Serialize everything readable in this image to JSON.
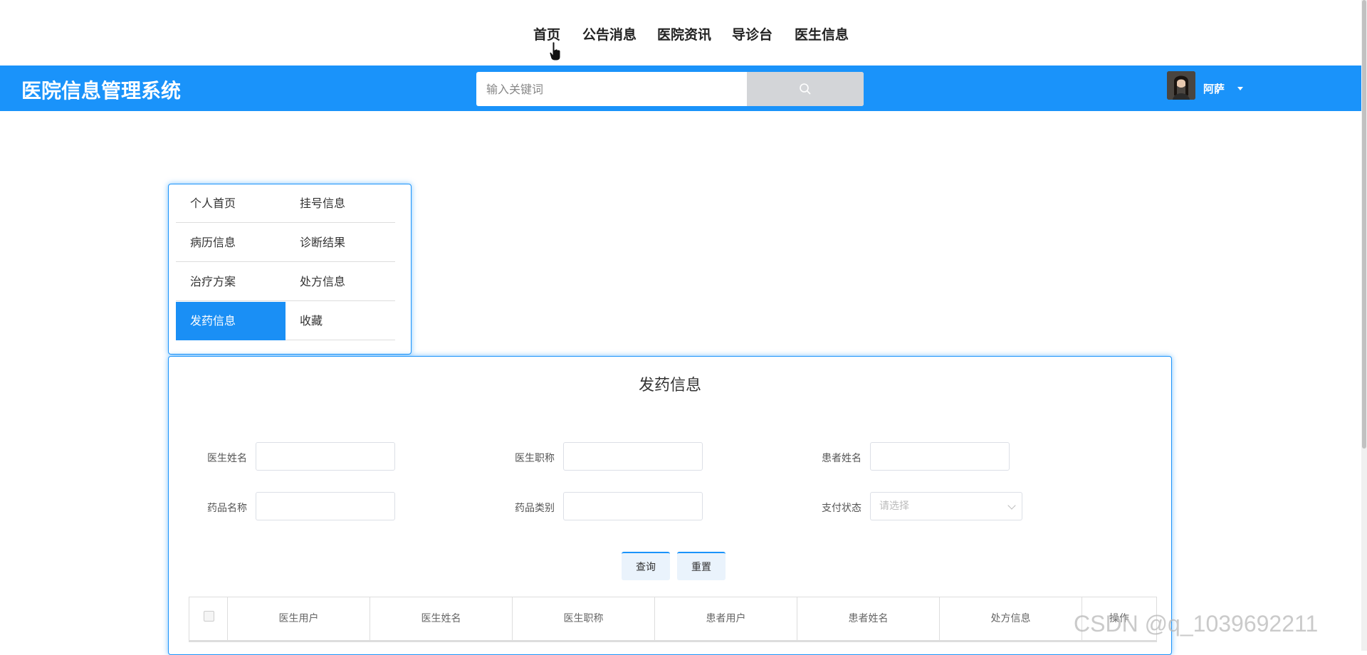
{
  "top_nav": {
    "items": [
      "首页",
      "公告消息",
      "医院资讯",
      "导诊台",
      "医生信息"
    ]
  },
  "header": {
    "logo": "医院信息管理系统",
    "search_placeholder": "输入关键词",
    "username": "阿萨",
    "icons": {
      "search": "search-icon",
      "dropdown": "caret-down-icon"
    }
  },
  "side_menu": {
    "items": [
      "个人首页",
      "挂号信息",
      "病历信息",
      "诊断结果",
      "治疗方案",
      "处方信息",
      "发药信息",
      "收藏"
    ],
    "active": "发药信息"
  },
  "panel": {
    "title": "发药信息",
    "filters": {
      "doctor_name": "医生姓名",
      "doctor_title": "医生职称",
      "patient_name": "患者姓名",
      "drug_name": "药品名称",
      "drug_category": "药品类别",
      "payment_status": "支付状态",
      "payment_status_placeholder": "请选择"
    },
    "buttons": {
      "query": "查询",
      "reset": "重置"
    },
    "table": {
      "columns": [
        "医生用户",
        "医生姓名",
        "医生职称",
        "患者用户",
        "患者姓名",
        "处方信息",
        "操作"
      ]
    }
  },
  "watermark": "CSDN @q_1039692211",
  "colors": {
    "primary": "#1a93fa",
    "active_menu": "#1a8ff5",
    "search_button": "#d3d5d8"
  }
}
